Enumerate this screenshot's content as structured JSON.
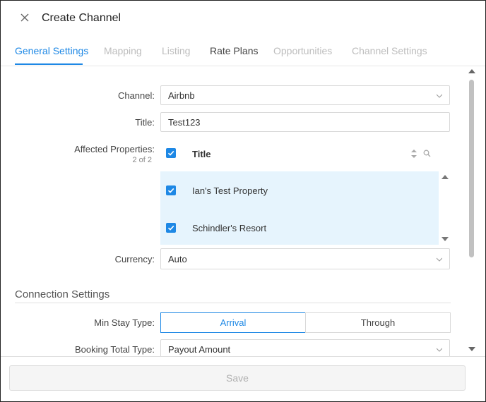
{
  "header": {
    "title": "Create Channel",
    "close_icon": "close-icon"
  },
  "tabs": [
    {
      "label": "General Settings",
      "state": "active"
    },
    {
      "label": "Mapping",
      "state": "disabled"
    },
    {
      "label": "Listing",
      "state": "disabled"
    },
    {
      "label": "Rate Plans",
      "state": "enabled"
    },
    {
      "label": "Opportunities",
      "state": "disabled"
    },
    {
      "label": "Channel Settings",
      "state": "disabled"
    }
  ],
  "form": {
    "channel": {
      "label": "Channel:",
      "value": "Airbnb"
    },
    "title": {
      "label": "Title:",
      "value": "Test123"
    },
    "affected": {
      "label": "Affected Properties:",
      "count": "2 of 2",
      "column_header": "Title",
      "rows": [
        {
          "name": "Ian's Test Property",
          "checked": true
        },
        {
          "name": "Schindler's Resort",
          "checked": true
        }
      ]
    },
    "currency": {
      "label": "Currency:",
      "value": "Auto"
    }
  },
  "connection": {
    "section_title": "Connection Settings",
    "min_stay": {
      "label": "Min Stay Type:",
      "options": [
        "Arrival",
        "Through"
      ],
      "selected": "Arrival"
    },
    "booking_total": {
      "label": "Booking Total Type:",
      "value": "Payout Amount"
    }
  },
  "footer": {
    "save_label": "Save"
  },
  "colors": {
    "accent": "#1e88e5",
    "row_highlight": "#e6f4fd"
  }
}
